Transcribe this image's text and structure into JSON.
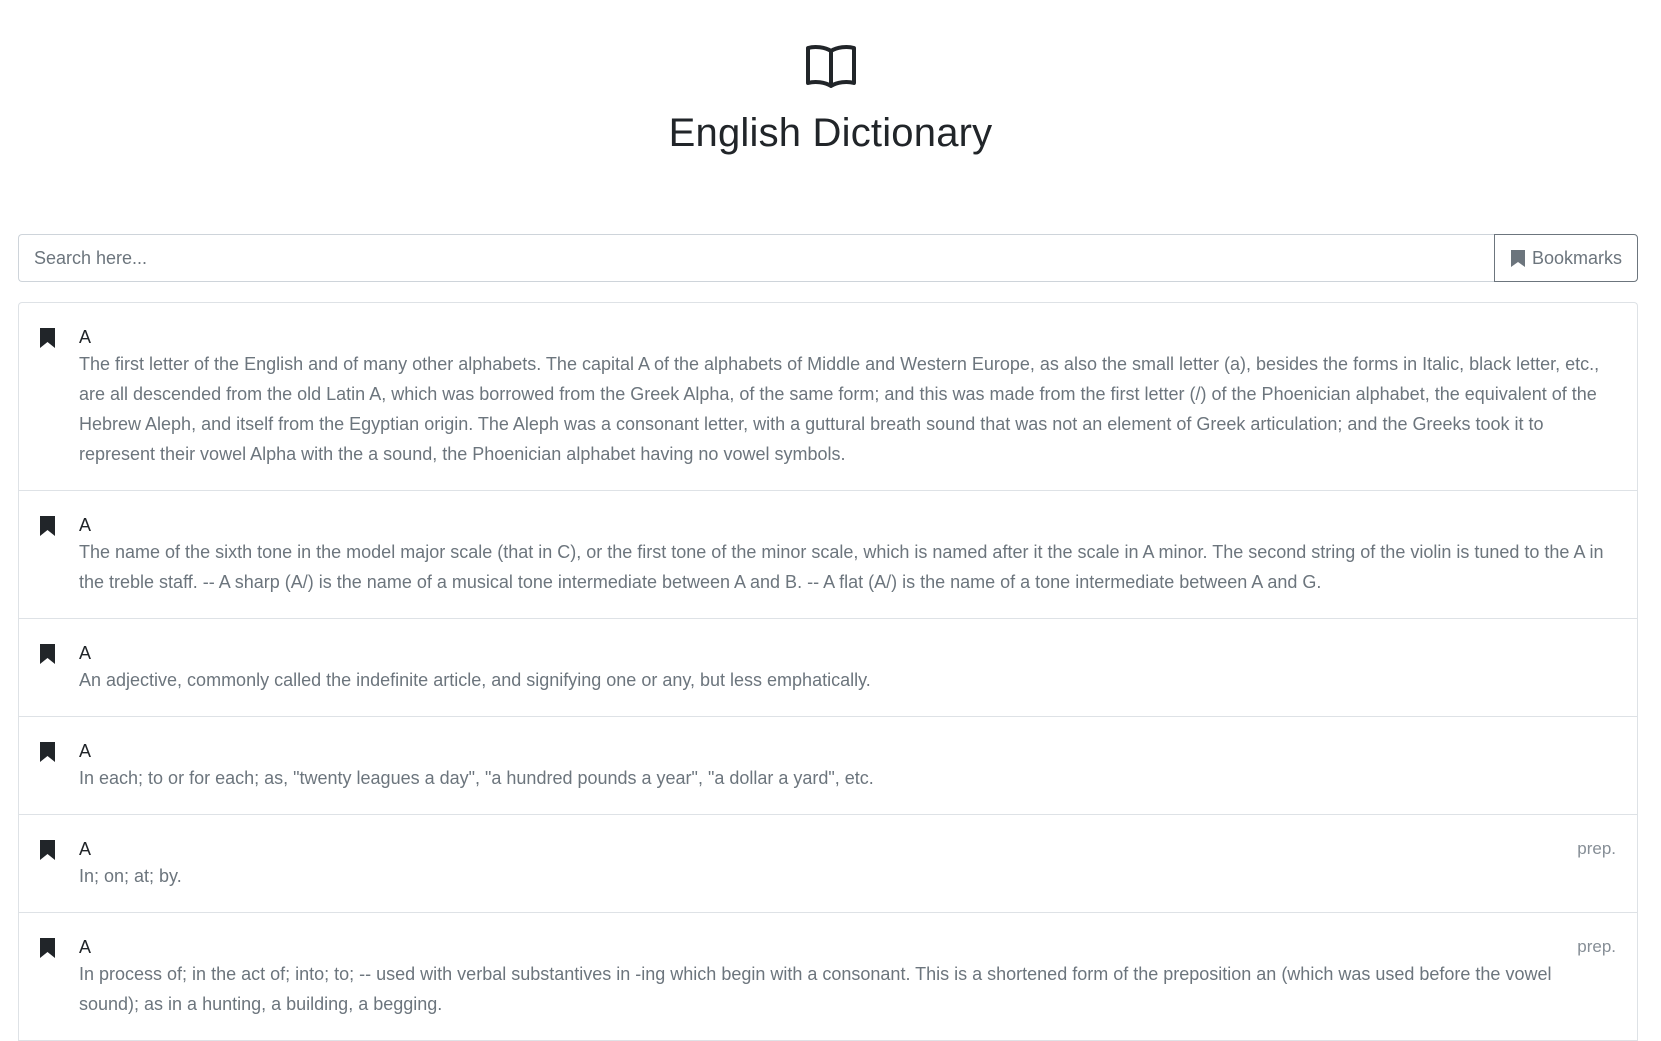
{
  "header": {
    "icon": "open-book-icon",
    "title": "English Dictionary"
  },
  "search": {
    "placeholder": "Search here...",
    "value": ""
  },
  "bookmarks_button": {
    "icon": "bookmark-icon",
    "label": "Bookmarks"
  },
  "entries": [
    {
      "word": "A",
      "pos": "",
      "definition": "The first letter of the English and of many other alphabets. The capital A of the alphabets of Middle and Western Europe, as also the small letter (a), besides the forms in Italic, black letter, etc., are all descended from the old Latin A, which was borrowed from the Greek Alpha, of the same form; and this was made from the first letter (/) of the Phoenician alphabet, the equivalent of the Hebrew Aleph, and itself from the Egyptian origin. The Aleph was a consonant letter, with a guttural breath sound that was not an element of Greek articulation; and the Greeks took it to represent their vowel Alpha with the a sound, the Phoenician alphabet having no vowel symbols."
    },
    {
      "word": "A",
      "pos": "",
      "definition": "The name of the sixth tone in the model major scale (that in C), or the first tone of the minor scale, which is named after it the scale in A minor. The second string of the violin is tuned to the A in the treble staff. -- A sharp (A/) is the name of a musical tone intermediate between A and B. -- A flat (A/) is the name of a tone intermediate between A and G."
    },
    {
      "word": "A",
      "pos": "",
      "definition": "An adjective, commonly called the indefinite article, and signifying one or any, but less emphatically."
    },
    {
      "word": "A",
      "pos": "",
      "definition": "In each; to or for each; as, \"twenty leagues a day\", \"a hundred pounds a year\", \"a dollar a yard\", etc."
    },
    {
      "word": "A",
      "pos": "prep.",
      "definition": "In; on; at; by."
    },
    {
      "word": "A",
      "pos": "prep.",
      "definition": "In process of; in the act of; into; to; -- used with verbal substantives in -ing which begin with a consonant. This is a shortened form of the preposition an (which was used before the vowel sound); as in a hunting, a building, a begging."
    }
  ]
}
